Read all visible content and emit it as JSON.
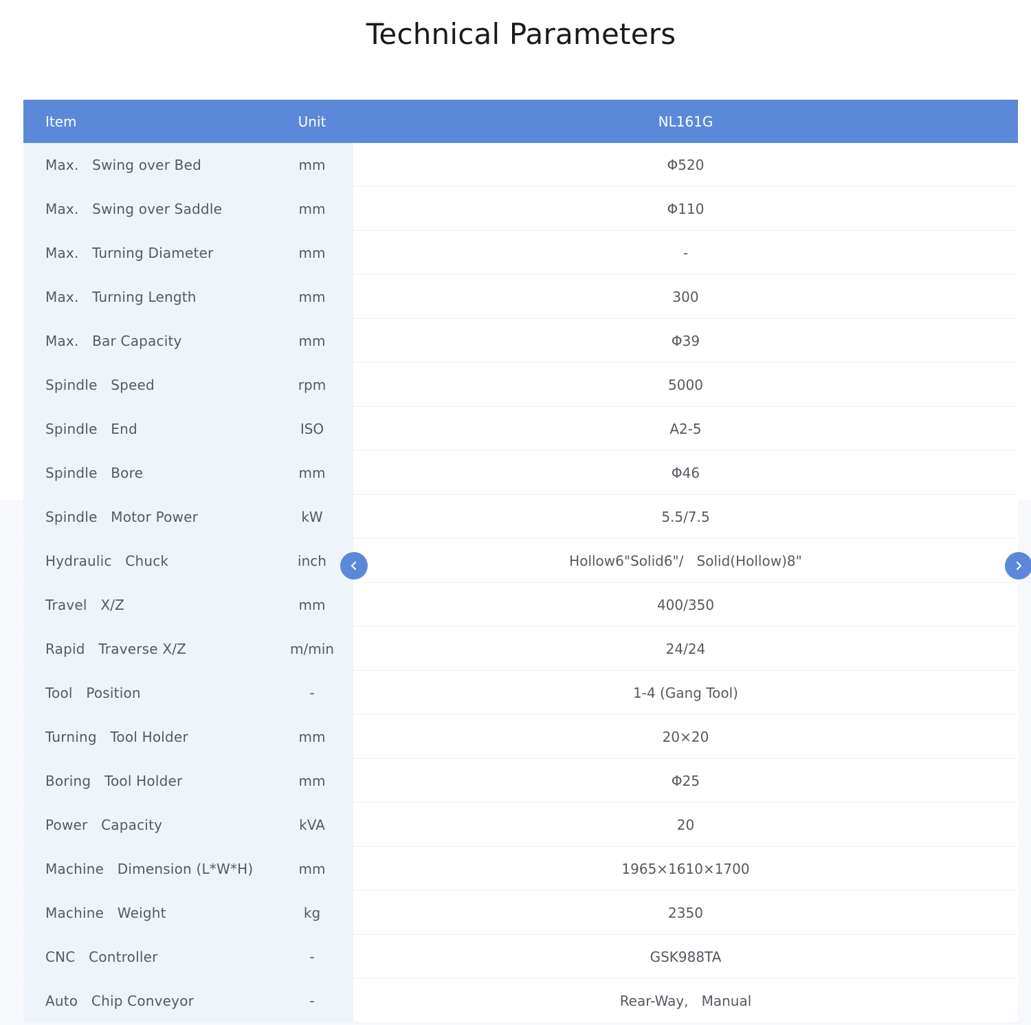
{
  "page": {
    "title": "Technical Parameters"
  },
  "table": {
    "headers": {
      "item": "Item",
      "unit": "Unit",
      "model": "NL161G"
    },
    "rows": [
      {
        "item": "Max.   Swing over Bed",
        "unit": "mm",
        "value": "Φ520"
      },
      {
        "item": "Max.   Swing over Saddle",
        "unit": "mm",
        "value": "Φ110"
      },
      {
        "item": "Max.   Turning Diameter",
        "unit": "mm",
        "value": "-"
      },
      {
        "item": "Max.   Turning Length",
        "unit": "mm",
        "value": "300"
      },
      {
        "item": "Max.   Bar Capacity",
        "unit": "mm",
        "value": "Φ39"
      },
      {
        "item": "Spindle   Speed",
        "unit": "rpm",
        "value": "5000"
      },
      {
        "item": "Spindle   End",
        "unit": "ISO",
        "value": "A2-5"
      },
      {
        "item": "Spindle   Bore",
        "unit": "mm",
        "value": "Φ46"
      },
      {
        "item": "Spindle   Motor Power",
        "unit": "kW",
        "value": "5.5/7.5"
      },
      {
        "item": "Hydraulic   Chuck",
        "unit": "inch",
        "value": "Hollow6\"Solid6\"/   Solid(Hollow)8\""
      },
      {
        "item": "Travel   X/Z",
        "unit": "mm",
        "value": "400/350"
      },
      {
        "item": "Rapid   Traverse X/Z",
        "unit": "m/min",
        "value": "24/24"
      },
      {
        "item": "Tool   Position",
        "unit": "-",
        "value": "1-4 (Gang Tool)"
      },
      {
        "item": "Turning   Tool Holder",
        "unit": "mm",
        "value": "20×20"
      },
      {
        "item": "Boring   Tool Holder",
        "unit": "mm",
        "value": "Φ25"
      },
      {
        "item": "Power   Capacity",
        "unit": "kVA",
        "value": "20"
      },
      {
        "item": "Machine   Dimension (L*W*H)",
        "unit": "mm",
        "value": "1965×1610×1700"
      },
      {
        "item": "Machine   Weight",
        "unit": "kg",
        "value": "2350"
      },
      {
        "item": "CNC   Controller",
        "unit": "-",
        "value": "GSK988TA"
      },
      {
        "item": "Auto   Chip Conveyor",
        "unit": "-",
        "value": "Rear-Way,   Manual"
      }
    ]
  },
  "navigation": {
    "prev_icon": "chevron-left-icon",
    "next_icon": "chevron-right-icon",
    "color": "#5b88d9"
  }
}
